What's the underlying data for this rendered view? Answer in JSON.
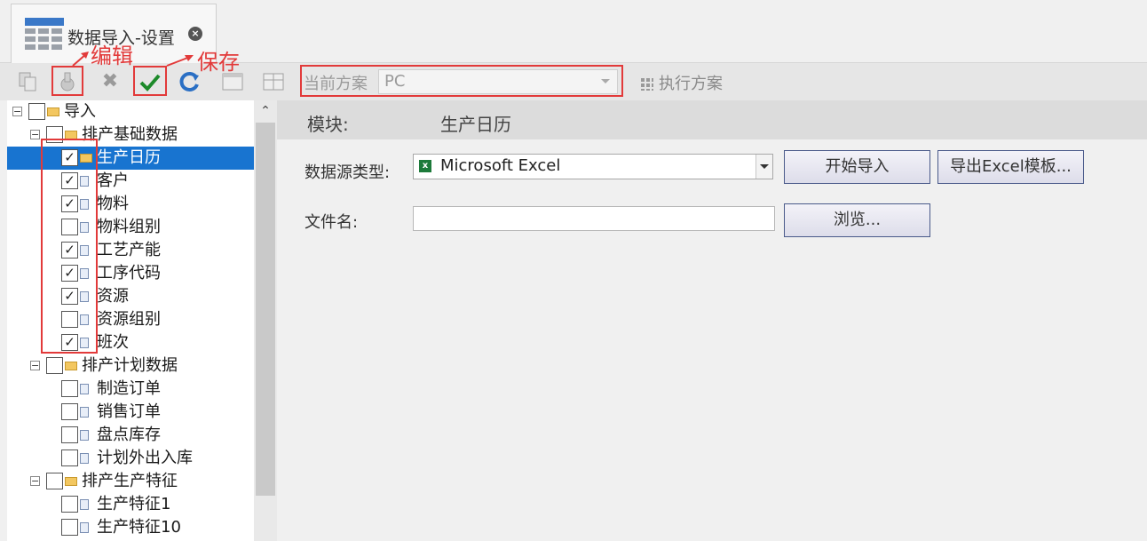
{
  "tab": {
    "title": "数据导入-设置",
    "close": "×"
  },
  "annotations": {
    "edit": "编辑",
    "save": "保存"
  },
  "toolbar": {
    "icons": [
      "copy-icon",
      "edit-icon",
      "delete-icon",
      "save-check-icon",
      "refresh-icon",
      "window-icon",
      "grid-icon"
    ],
    "scheme_label": "当前方案",
    "scheme_value": "PC",
    "execute_label": "执行方案"
  },
  "tree": {
    "items": [
      {
        "label": "导入",
        "level": 0,
        "type": "folder",
        "checked": false,
        "expander": "−"
      },
      {
        "label": "排产基础数据",
        "level": 1,
        "type": "folder",
        "checked": false,
        "expander": "−"
      },
      {
        "label": "生产日历",
        "level": 2,
        "type": "folder",
        "checked": true,
        "selected": true
      },
      {
        "label": "客户",
        "level": 2,
        "type": "leaf",
        "checked": true
      },
      {
        "label": "物料",
        "level": 2,
        "type": "leaf",
        "checked": true
      },
      {
        "label": "物料组别",
        "level": 2,
        "type": "leaf",
        "checked": false
      },
      {
        "label": "工艺产能",
        "level": 2,
        "type": "leaf",
        "checked": true
      },
      {
        "label": "工序代码",
        "level": 2,
        "type": "leaf",
        "checked": true
      },
      {
        "label": "资源",
        "level": 2,
        "type": "leaf",
        "checked": true
      },
      {
        "label": "资源组别",
        "level": 2,
        "type": "leaf",
        "checked": false
      },
      {
        "label": "班次",
        "level": 2,
        "type": "leaf",
        "checked": true
      },
      {
        "label": "排产计划数据",
        "level": 1,
        "type": "folder",
        "checked": false,
        "expander": "−"
      },
      {
        "label": "制造订单",
        "level": 2,
        "type": "leaf",
        "checked": false
      },
      {
        "label": "销售订单",
        "level": 2,
        "type": "leaf",
        "checked": false
      },
      {
        "label": "盘点库存",
        "level": 2,
        "type": "leaf",
        "checked": false
      },
      {
        "label": "计划外出入库",
        "level": 2,
        "type": "leaf",
        "checked": false
      },
      {
        "label": "排产生产特征",
        "level": 1,
        "type": "folder",
        "checked": false,
        "expander": "−"
      },
      {
        "label": "生产特征1",
        "level": 2,
        "type": "leaf",
        "checked": false
      },
      {
        "label": "生产特征10",
        "level": 2,
        "type": "leaf",
        "checked": false
      }
    ]
  },
  "panel": {
    "module_label": "模块:",
    "module_value": "生产日历",
    "datasource_label": "数据源类型:",
    "datasource_value": "Microsoft Excel",
    "filename_label": "文件名:",
    "filename_value": "",
    "start_import": "开始导入",
    "export_template": "导出Excel模板...",
    "browse": "浏览..."
  }
}
